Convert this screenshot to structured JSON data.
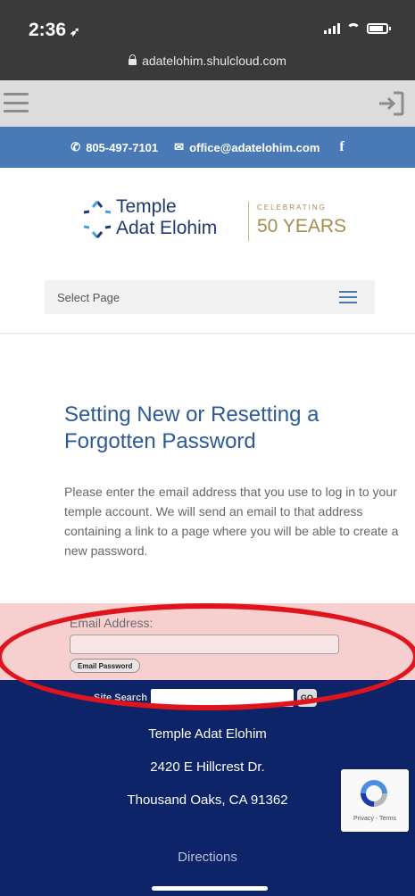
{
  "status_bar": {
    "time": "2:36",
    "url": "adatelohim.shulcloud.com"
  },
  "contact": {
    "phone": "805-497-7101",
    "email": "office@adatelohim.com",
    "facebook": "f"
  },
  "logo": {
    "line1": "Temple",
    "line2": "Adat Elohim",
    "celebrating": "CELEBRATING",
    "years": "50 YEARS"
  },
  "nav": {
    "select_page": "Select Page"
  },
  "main": {
    "title": "Setting New or Resetting a Forgotten Password",
    "intro": "Please enter the email address that you use to log in to your temple account. We will send an email to that address containing a link to a page where you will be able to create a new password.",
    "email_label": "Email Address:",
    "email_value": "",
    "submit_label": "Email Password"
  },
  "footer": {
    "site_search_label": "Site Search",
    "go_label": "GO",
    "name": "Temple Adat Elohim",
    "street": "2420 E Hillcrest Dr.",
    "city": "Thousand Oaks, CA 91362",
    "directions": "Directions"
  },
  "recaptcha": {
    "links": "Privacy - Terms"
  },
  "colors": {
    "contact_bar": "#4a7ab5",
    "title_blue": "#2e5a96",
    "footer_navy": "#0e2468",
    "highlight_red": "#e0141d",
    "logo_gold": "#a58c50"
  }
}
